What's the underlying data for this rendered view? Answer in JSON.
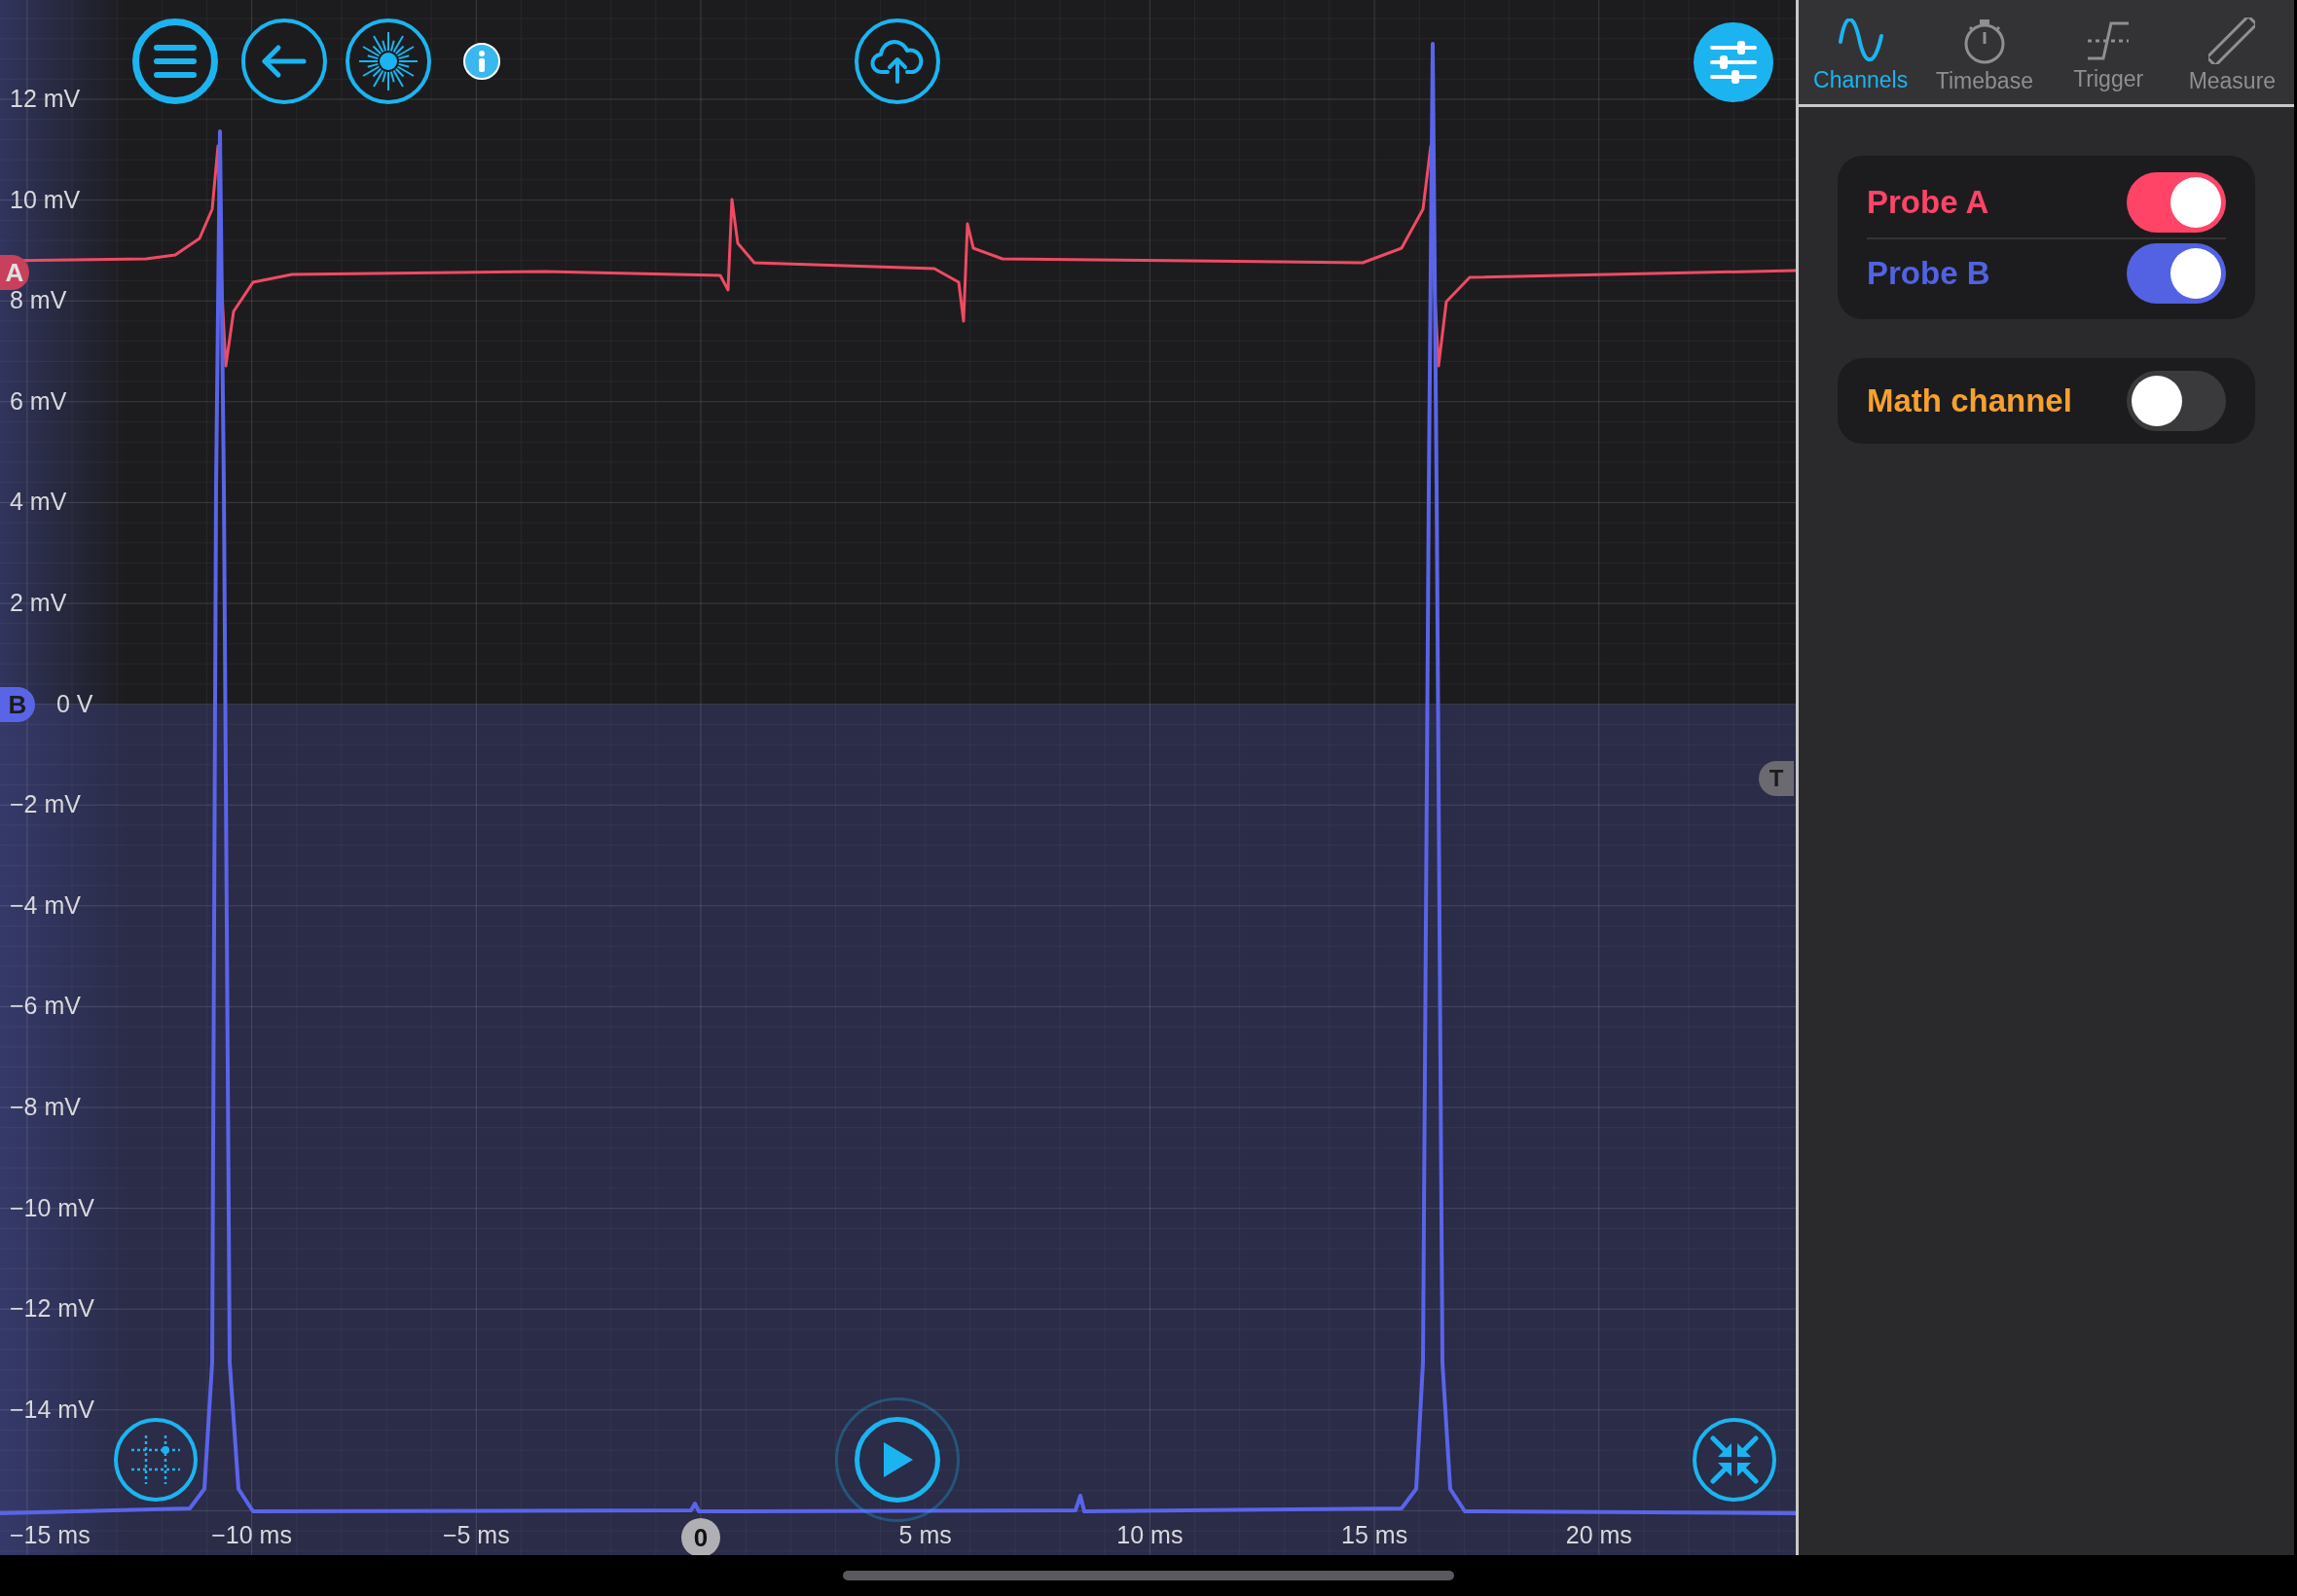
{
  "plot": {
    "y_axis_labels": [
      "12 mV",
      "10 mV",
      "8 mV",
      "6 mV",
      "4 mV",
      "2 mV",
      "0 V",
      "−2 mV",
      "−4 mV",
      "−6 mV",
      "−8 mV",
      "−10 mV",
      "−12 mV",
      "−14 mV"
    ],
    "x_axis_labels": [
      "−15 ms",
      "−10 ms",
      "−5 ms",
      "5 ms",
      "10 ms",
      "15 ms",
      "20 ms"
    ],
    "markers": [
      {
        "kind": "channel_a",
        "label": "A",
        "color": "#c8405c"
      },
      {
        "kind": "channel_b",
        "label": "B",
        "color": "#5a64e6"
      },
      {
        "kind": "trigger",
        "label": "T"
      },
      {
        "kind": "time_zero",
        "label": "0"
      }
    ]
  },
  "sidebar": {
    "tabs": [
      {
        "label": "Channels",
        "selected": true
      },
      {
        "label": "Timebase",
        "selected": false
      },
      {
        "label": "Trigger",
        "selected": false
      },
      {
        "label": "Measure",
        "selected": false
      }
    ],
    "probes": [
      {
        "label": "Probe A",
        "color": "#ff4468",
        "on": true
      },
      {
        "label": "Probe B",
        "color": "#5262e2",
        "on": true
      }
    ],
    "math_channel": {
      "label": "Math channel",
      "color": "#f5a030",
      "on": false
    }
  }
}
